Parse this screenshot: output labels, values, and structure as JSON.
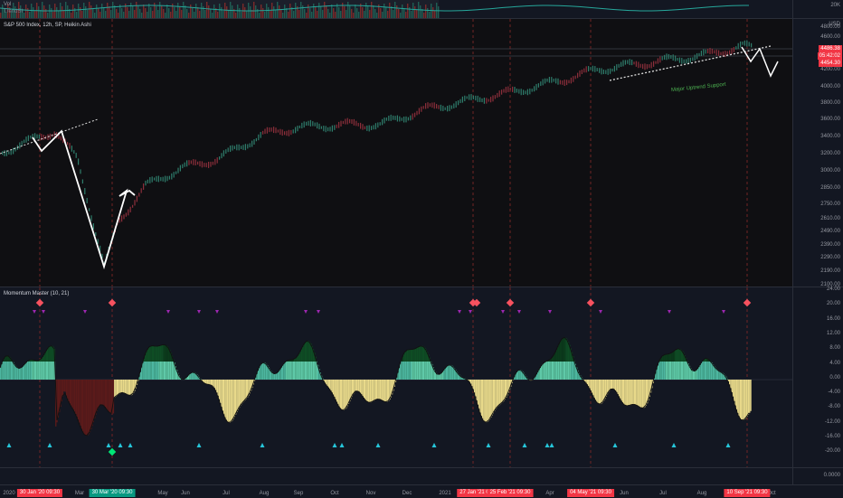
{
  "top_pane": {
    "labels": [
      "Vol",
      "TrendSI"
    ],
    "scale_label": "20K"
  },
  "price_pane": {
    "title": "S&P 500 Index, 12h, SP, Heikin Ashi",
    "currency": "USD",
    "axis_ticks": [
      "4800.00",
      "4600.00",
      "4400.00",
      "4200.00",
      "4000.00",
      "3800.00",
      "3600.00",
      "3400.00",
      "3200.00",
      "3000.00",
      "2850.00",
      "2750.00",
      "2610.00",
      "2490.00",
      "2390.00",
      "2290.00",
      "2190.00",
      "2100.00"
    ],
    "price_tags": [
      "4486.38",
      "05:42:02",
      "4454.30"
    ],
    "annotation": "Major Uptrend Support"
  },
  "osc_pane": {
    "title": "Momentum Master (10, 21)",
    "axis_ticks": [
      "24.00",
      "20.00",
      "16.00",
      "12.00",
      "8.00",
      "4.00",
      "0.00",
      "-4.00",
      "-8.00",
      "-12.00",
      "-16.00",
      "-20.00"
    ]
  },
  "bottom_pane": {
    "axis_tick": "0.0000"
  },
  "time_axis": {
    "labels": [
      "2020",
      "Mar",
      "May",
      "Jun",
      "Jul",
      "Aug",
      "Sep",
      "Oct",
      "Nov",
      "Dec",
      "2021",
      "Apr",
      "Jun",
      "Jul",
      "Aug",
      "Oct"
    ],
    "highlights": [
      "30 Jan '20   09:30",
      "30 Mar '20   09:30",
      "27 Jan '21   09:",
      "25 Feb '21   09:30",
      "04 May '21   09:30",
      "10 Sep '21   09:30"
    ]
  },
  "colors": {
    "background": "#131722",
    "sell_marker": "#f7525f",
    "buy_marker": "#26c6da",
    "green_marker": "#00e676",
    "purple_marker": "#9c27b0",
    "highlight_red": "#f23645",
    "highlight_green": "#089981"
  }
}
